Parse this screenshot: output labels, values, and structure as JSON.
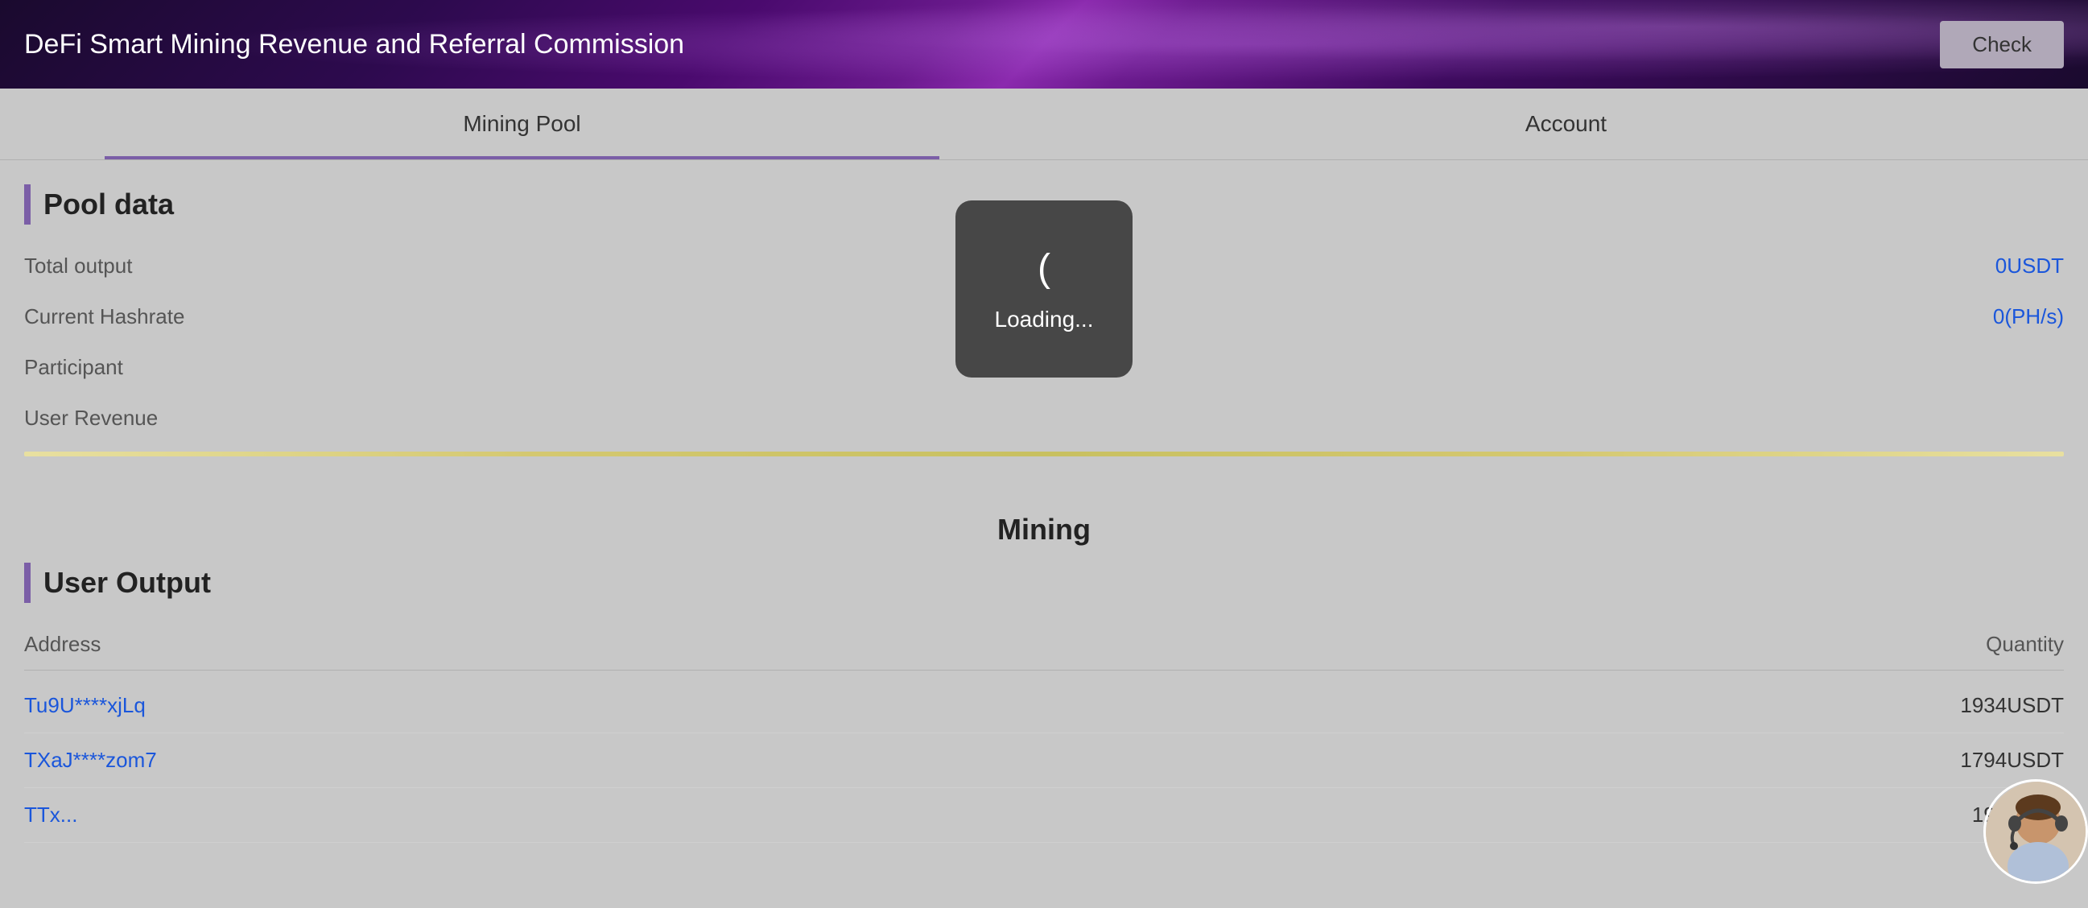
{
  "header": {
    "title": "DeFi Smart Mining Revenue and Referral Commission",
    "check_button": "Check"
  },
  "tabs": [
    {
      "id": "mining-pool",
      "label": "Mining Pool",
      "active": true
    },
    {
      "id": "account",
      "label": "Account",
      "active": false
    }
  ],
  "pool_data": {
    "section_title": "Pool data",
    "rows": [
      {
        "label": "Total output",
        "value": "0USDT",
        "value_color": "blue"
      },
      {
        "label": "Current Hashrate",
        "value": "0(PH/s)",
        "value_color": "blue"
      },
      {
        "label": "Participant",
        "value": "",
        "value_color": "normal"
      },
      {
        "label": "User Revenue",
        "value": "",
        "value_color": "normal"
      }
    ]
  },
  "mining_section": {
    "title": "Mining"
  },
  "user_output": {
    "section_title": "User Output",
    "table_header": {
      "address_col": "Address",
      "quantity_col": "Quantity"
    },
    "rows": [
      {
        "address": "Tu9U****xjLq",
        "quantity": "1934USDT"
      },
      {
        "address": "TXaJ****zom7",
        "quantity": "1794USDT"
      },
      {
        "address": "TTx...",
        "quantity": "190USDT"
      }
    ]
  },
  "loading": {
    "icon": "(",
    "text": "Loading..."
  },
  "colors": {
    "accent_purple": "#7b5ea7",
    "blue_link": "#1a56db",
    "background": "#c8c8c8"
  }
}
